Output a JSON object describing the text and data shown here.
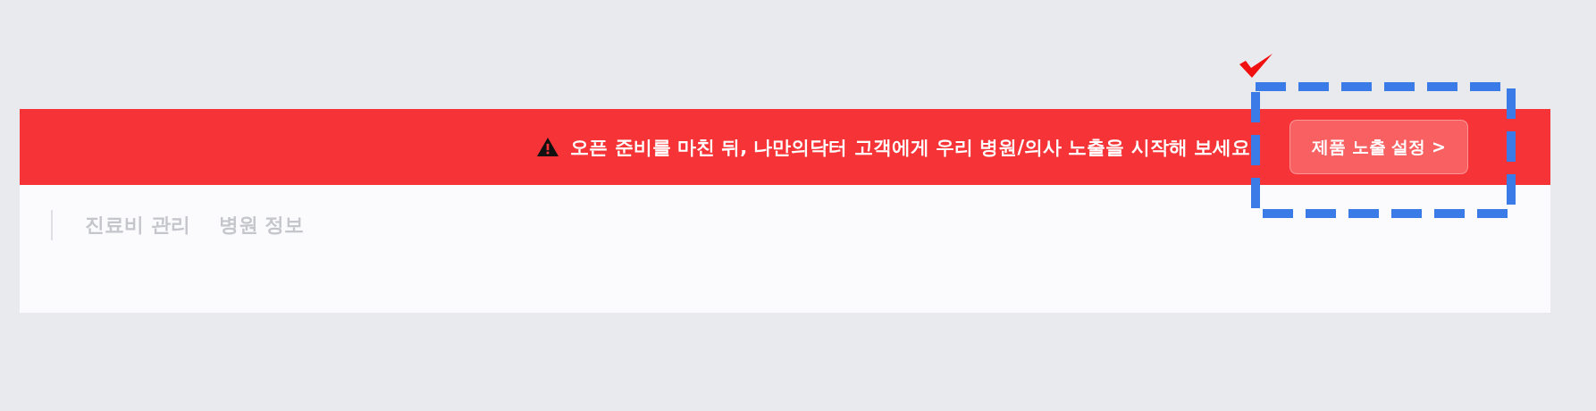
{
  "banner": {
    "message": "오픈 준비를 마친 뒤, 나만의닥터 고객에게 우리 병원/의사 노출을 시작해 보세요",
    "button": "제품 노출 설정",
    "button_chevron": ">"
  },
  "tabs": [
    {
      "label": "진료비 관리",
      "selected": false
    },
    {
      "label": "병원 정보",
      "selected": false
    }
  ]
}
